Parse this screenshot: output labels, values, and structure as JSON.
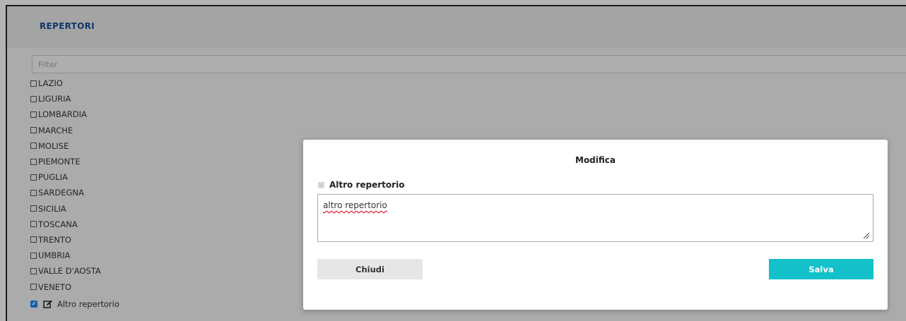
{
  "panel": {
    "title": "REPERTORI",
    "filter_placeholder": "Filter"
  },
  "list": {
    "items": [
      {
        "label": "LAZIO",
        "checked": false
      },
      {
        "label": "LIGURIA",
        "checked": false
      },
      {
        "label": "LOMBARDIA",
        "checked": false
      },
      {
        "label": "MARCHE",
        "checked": false
      },
      {
        "label": "MOLISE",
        "checked": false
      },
      {
        "label": "PIEMONTE",
        "checked": false
      },
      {
        "label": "PUGLIA",
        "checked": false
      },
      {
        "label": "SARDEGNA",
        "checked": false
      },
      {
        "label": "SICILIA",
        "checked": false
      },
      {
        "label": "TOSCANA",
        "checked": false
      },
      {
        "label": "TRENTO",
        "checked": false
      },
      {
        "label": "UMBRIA",
        "checked": false
      },
      {
        "label": "VALLE D'AOSTA",
        "checked": false
      },
      {
        "label": "VENETO",
        "checked": false
      }
    ],
    "custom_item": {
      "label": "Altro repertorio",
      "checked": true,
      "icon": "edit-icon"
    }
  },
  "modal": {
    "title": "Modifica",
    "checkbox_label": "Altro repertorio",
    "checkbox_checked": true,
    "textarea_value": "altro repertorio",
    "close_label": "Chiudi",
    "save_label": "Salva"
  },
  "colors": {
    "accent": "#12c1c9",
    "title": "#10386b",
    "checkbox": "#1d5fa8"
  }
}
